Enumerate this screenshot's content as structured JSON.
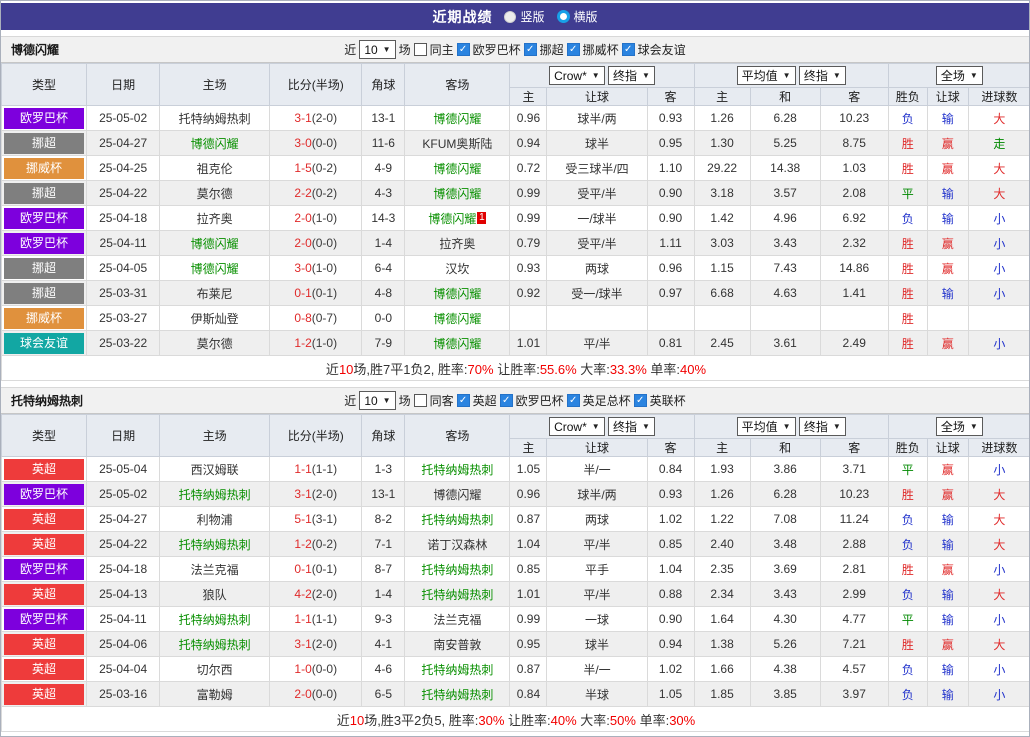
{
  "page": {
    "title": "近期战绩",
    "view_options": [
      {
        "label": "竖版",
        "selected": false
      },
      {
        "label": "横版",
        "selected": true
      }
    ]
  },
  "odds_header": {
    "cols_main": [
      "类型",
      "日期",
      "主场",
      "比分(半场)",
      "角球",
      "客场"
    ],
    "book_select": "Crow*",
    "final_select": "终指",
    "avg_select": "平均值",
    "scope_select": "全场",
    "crow_sub": [
      "主",
      "让球",
      "客"
    ],
    "avg_sub": [
      "主",
      "和",
      "客"
    ],
    "result_sub": [
      "胜负",
      "让球",
      "进球数"
    ]
  },
  "filter_labels": {
    "near": "近",
    "games_value": "10",
    "games": "场"
  },
  "league_colors": {
    "欧罗巴杯": "#7d00dd",
    "挪超": "#7f7f7f",
    "挪威杯": "#e0913d",
    "球会友谊": "#12a7a3",
    "英超": "#ee3b3b"
  },
  "result_colors": {
    "胜": "red",
    "平": "green",
    "负": "blue",
    "赢": "red",
    "输": "blue",
    "走": "green",
    "大": "red",
    "小": "blue"
  },
  "sections": [
    {
      "team": "博德闪耀",
      "same_label": "同主",
      "near_value": "10",
      "leagues": [
        "欧罗巴杯",
        "挪超",
        "挪威杯",
        "球会友谊"
      ],
      "rows": [
        {
          "league": "欧罗巴杯",
          "date": "25-05-02",
          "home": "托特纳姆热刺",
          "home_focus": false,
          "ft": "3-1",
          "ht": "(2-0)",
          "corner": "13-1",
          "away": "博德闪耀",
          "away_focus": true,
          "away_card": "",
          "odds": [
            "0.96",
            "球半/两",
            "0.93"
          ],
          "avg": [
            "1.26",
            "6.28",
            "10.23"
          ],
          "result": [
            "负",
            "输",
            "大"
          ]
        },
        {
          "league": "挪超",
          "date": "25-04-27",
          "home": "博德闪耀",
          "home_focus": true,
          "ft": "3-0",
          "ht": "(0-0)",
          "corner": "11-6",
          "away": "KFUM奥斯陆",
          "away_focus": false,
          "away_card": "",
          "odds": [
            "0.94",
            "球半",
            "0.95"
          ],
          "avg": [
            "1.30",
            "5.25",
            "8.75"
          ],
          "result": [
            "胜",
            "赢",
            "走"
          ]
        },
        {
          "league": "挪威杯",
          "date": "25-04-25",
          "home": "祖克伦",
          "home_focus": false,
          "ft": "1-5",
          "ht": "(0-2)",
          "corner": "4-9",
          "away": "博德闪耀",
          "away_focus": true,
          "away_card": "",
          "odds": [
            "0.72",
            "受三球半/四",
            "1.10"
          ],
          "avg": [
            "29.22",
            "14.38",
            "1.03"
          ],
          "result": [
            "胜",
            "赢",
            "大"
          ]
        },
        {
          "league": "挪超",
          "date": "25-04-22",
          "home": "莫尔德",
          "home_focus": false,
          "ft": "2-2",
          "ht": "(0-2)",
          "corner": "4-3",
          "away": "博德闪耀",
          "away_focus": true,
          "away_card": "",
          "odds": [
            "0.99",
            "受平/半",
            "0.90"
          ],
          "avg": [
            "3.18",
            "3.57",
            "2.08"
          ],
          "result": [
            "平",
            "输",
            "大"
          ]
        },
        {
          "league": "欧罗巴杯",
          "date": "25-04-18",
          "home": "拉齐奥",
          "home_focus": false,
          "ft": "2-0",
          "ht": "(1-0)",
          "corner": "14-3",
          "away": "博德闪耀",
          "away_focus": true,
          "away_card": "1",
          "odds": [
            "0.99",
            "一/球半",
            "0.90"
          ],
          "avg": [
            "1.42",
            "4.96",
            "6.92"
          ],
          "result": [
            "负",
            "输",
            "小"
          ]
        },
        {
          "league": "欧罗巴杯",
          "date": "25-04-11",
          "home": "博德闪耀",
          "home_focus": true,
          "ft": "2-0",
          "ht": "(0-0)",
          "corner": "1-4",
          "away": "拉齐奥",
          "away_focus": false,
          "away_card": "",
          "odds": [
            "0.79",
            "受平/半",
            "1.11"
          ],
          "avg": [
            "3.03",
            "3.43",
            "2.32"
          ],
          "result": [
            "胜",
            "赢",
            "小"
          ]
        },
        {
          "league": "挪超",
          "date": "25-04-05",
          "home": "博德闪耀",
          "home_focus": true,
          "ft": "3-0",
          "ht": "(1-0)",
          "corner": "6-4",
          "away": "汉坎",
          "away_focus": false,
          "away_card": "",
          "odds": [
            "0.93",
            "两球",
            "0.96"
          ],
          "avg": [
            "1.15",
            "7.43",
            "14.86"
          ],
          "result": [
            "胜",
            "赢",
            "小"
          ]
        },
        {
          "league": "挪超",
          "date": "25-03-31",
          "home": "布莱尼",
          "home_focus": false,
          "ft": "0-1",
          "ht": "(0-1)",
          "corner": "4-8",
          "away": "博德闪耀",
          "away_focus": true,
          "away_card": "",
          "odds": [
            "0.92",
            "受一/球半",
            "0.97"
          ],
          "avg": [
            "6.68",
            "4.63",
            "1.41"
          ],
          "result": [
            "胜",
            "输",
            "小"
          ]
        },
        {
          "league": "挪威杯",
          "date": "25-03-27",
          "home": "伊斯灿登",
          "home_focus": false,
          "ft": "0-8",
          "ht": "(0-7)",
          "corner": "0-0",
          "away": "博德闪耀",
          "away_focus": true,
          "away_card": "",
          "odds": [
            "",
            "",
            ""
          ],
          "avg": [
            "",
            "",
            ""
          ],
          "result": [
            "胜",
            "",
            ""
          ]
        },
        {
          "league": "球会友谊",
          "date": "25-03-22",
          "home": "莫尔德",
          "home_focus": false,
          "ft": "1-2",
          "ht": "(1-0)",
          "corner": "7-9",
          "away": "博德闪耀",
          "away_focus": true,
          "away_card": "",
          "odds": [
            "1.01",
            "平/半",
            "0.81"
          ],
          "avg": [
            "2.45",
            "3.61",
            "2.49"
          ],
          "result": [
            "胜",
            "赢",
            "小"
          ]
        }
      ],
      "summary": [
        {
          "t": "近",
          "c": "sk"
        },
        {
          "t": "10",
          "c": "sr"
        },
        {
          "t": "场,胜7平1负2, 胜率:",
          "c": "sk"
        },
        {
          "t": "70%",
          "c": "sr"
        },
        {
          "t": " 让胜率:",
          "c": "sk"
        },
        {
          "t": "55.6%",
          "c": "sr"
        },
        {
          "t": " 大率:",
          "c": "sk"
        },
        {
          "t": "33.3%",
          "c": "sr"
        },
        {
          "t": " 单率:",
          "c": "sk"
        },
        {
          "t": "40%",
          "c": "sr"
        }
      ]
    },
    {
      "team": "托特纳姆热刺",
      "same_label": "同客",
      "near_value": "10",
      "leagues": [
        "英超",
        "欧罗巴杯",
        "英足总杯",
        "英联杯"
      ],
      "rows": [
        {
          "league": "英超",
          "date": "25-05-04",
          "home": "西汉姆联",
          "home_focus": false,
          "ft": "1-1",
          "ht": "(1-1)",
          "corner": "1-3",
          "away": "托特纳姆热刺",
          "away_focus": true,
          "away_card": "",
          "odds": [
            "1.05",
            "半/一",
            "0.84"
          ],
          "avg": [
            "1.93",
            "3.86",
            "3.71"
          ],
          "result": [
            "平",
            "赢",
            "小"
          ]
        },
        {
          "league": "欧罗巴杯",
          "date": "25-05-02",
          "home": "托特纳姆热刺",
          "home_focus": true,
          "ft": "3-1",
          "ht": "(2-0)",
          "corner": "13-1",
          "away": "博德闪耀",
          "away_focus": false,
          "away_card": "",
          "odds": [
            "0.96",
            "球半/两",
            "0.93"
          ],
          "avg": [
            "1.26",
            "6.28",
            "10.23"
          ],
          "result": [
            "胜",
            "赢",
            "大"
          ]
        },
        {
          "league": "英超",
          "date": "25-04-27",
          "home": "利物浦",
          "home_focus": false,
          "ft": "5-1",
          "ht": "(3-1)",
          "corner": "8-2",
          "away": "托特纳姆热刺",
          "away_focus": true,
          "away_card": "",
          "odds": [
            "0.87",
            "两球",
            "1.02"
          ],
          "avg": [
            "1.22",
            "7.08",
            "11.24"
          ],
          "result": [
            "负",
            "输",
            "大"
          ]
        },
        {
          "league": "英超",
          "date": "25-04-22",
          "home": "托特纳姆热刺",
          "home_focus": true,
          "ft": "1-2",
          "ht": "(0-2)",
          "corner": "7-1",
          "away": "诺丁汉森林",
          "away_focus": false,
          "away_card": "",
          "odds": [
            "1.04",
            "平/半",
            "0.85"
          ],
          "avg": [
            "2.40",
            "3.48",
            "2.88"
          ],
          "result": [
            "负",
            "输",
            "大"
          ]
        },
        {
          "league": "欧罗巴杯",
          "date": "25-04-18",
          "home": "法兰克福",
          "home_focus": false,
          "ft": "0-1",
          "ht": "(0-1)",
          "corner": "8-7",
          "away": "托特纳姆热刺",
          "away_focus": true,
          "away_card": "",
          "odds": [
            "0.85",
            "平手",
            "1.04"
          ],
          "avg": [
            "2.35",
            "3.69",
            "2.81"
          ],
          "result": [
            "胜",
            "赢",
            "小"
          ]
        },
        {
          "league": "英超",
          "date": "25-04-13",
          "home": "狼队",
          "home_focus": false,
          "ft": "4-2",
          "ht": "(2-0)",
          "corner": "1-4",
          "away": "托特纳姆热刺",
          "away_focus": true,
          "away_card": "",
          "odds": [
            "1.01",
            "平/半",
            "0.88"
          ],
          "avg": [
            "2.34",
            "3.43",
            "2.99"
          ],
          "result": [
            "负",
            "输",
            "大"
          ]
        },
        {
          "league": "欧罗巴杯",
          "date": "25-04-11",
          "home": "托特纳姆热刺",
          "home_focus": true,
          "ft": "1-1",
          "ht": "(1-1)",
          "corner": "9-3",
          "away": "法兰克福",
          "away_focus": false,
          "away_card": "",
          "odds": [
            "0.99",
            "一球",
            "0.90"
          ],
          "avg": [
            "1.64",
            "4.30",
            "4.77"
          ],
          "result": [
            "平",
            "输",
            "小"
          ]
        },
        {
          "league": "英超",
          "date": "25-04-06",
          "home": "托特纳姆热刺",
          "home_focus": true,
          "ft": "3-1",
          "ht": "(2-0)",
          "corner": "4-1",
          "away": "南安普敦",
          "away_focus": false,
          "away_card": "",
          "odds": [
            "0.95",
            "球半",
            "0.94"
          ],
          "avg": [
            "1.38",
            "5.26",
            "7.21"
          ],
          "result": [
            "胜",
            "赢",
            "大"
          ]
        },
        {
          "league": "英超",
          "date": "25-04-04",
          "home": "切尔西",
          "home_focus": false,
          "ft": "1-0",
          "ht": "(0-0)",
          "corner": "4-6",
          "away": "托特纳姆热刺",
          "away_focus": true,
          "away_card": "",
          "odds": [
            "0.87",
            "半/一",
            "1.02"
          ],
          "avg": [
            "1.66",
            "4.38",
            "4.57"
          ],
          "result": [
            "负",
            "输",
            "小"
          ]
        },
        {
          "league": "英超",
          "date": "25-03-16",
          "home": "富勒姆",
          "home_focus": false,
          "ft": "2-0",
          "ht": "(0-0)",
          "corner": "6-5",
          "away": "托特纳姆热刺",
          "away_focus": true,
          "away_card": "",
          "odds": [
            "0.84",
            "半球",
            "1.05"
          ],
          "avg": [
            "1.85",
            "3.85",
            "3.97"
          ],
          "result": [
            "负",
            "输",
            "小"
          ]
        }
      ],
      "summary": [
        {
          "t": "近",
          "c": "sk"
        },
        {
          "t": "10",
          "c": "sr"
        },
        {
          "t": "场,胜3平2负5, 胜率:",
          "c": "sk"
        },
        {
          "t": "30%",
          "c": "sr"
        },
        {
          "t": " 让胜率:",
          "c": "sk"
        },
        {
          "t": "40%",
          "c": "sr"
        },
        {
          "t": " 大率:",
          "c": "sk"
        },
        {
          "t": "50%",
          "c": "sr"
        },
        {
          "t": " 单率:",
          "c": "sk"
        },
        {
          "t": "30%",
          "c": "sr"
        }
      ]
    }
  ]
}
